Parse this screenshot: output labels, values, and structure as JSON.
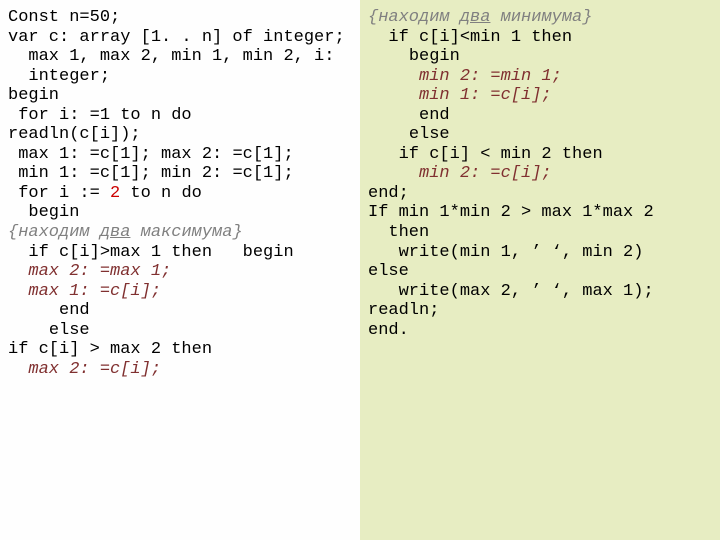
{
  "left": {
    "l01": "Const n=50;",
    "l02": "var c: array [1. . n] of integer;",
    "l03": "  max 1, max 2, min 1, min 2, i:",
    "l04": "  integer;",
    "l05": "begin",
    "l06": " for i: =1 to n do",
    "l07": "readln(c[i]);",
    "l08": " max 1: =c[1]; max 2: =c[1];",
    "l09": " min 1: =c[1]; min 2: =c[1];",
    "l10a": " for i := ",
    "l10b": "2",
    "l10c": " to n do",
    "l11": "  begin",
    "cmt_prefix": "{находим ",
    "cmt_word": "два",
    "cmt_suffix": " максимума}",
    "l13": "  if c[i]>max 1 then   begin",
    "l14": "  max 2: =max 1;",
    "l15": "  max 1: =c[i];",
    "l16": "     end",
    "l17": "    else",
    "l18": "if c[i] > max 2 then",
    "l19": "  max 2: =c[i];"
  },
  "right": {
    "cmt_prefix": "{находим ",
    "cmt_word": "два",
    "cmt_suffix": " минимума}",
    "r02": "  if c[i]<min 1 then",
    "r03": "    begin",
    "r04": "     min 2: =min 1;",
    "r05": "     min 1: =c[i];",
    "r06": "     end",
    "r07": "    else",
    "r08": "   if c[i] < min 2 then",
    "r09": "     min 2: =c[i];",
    "r10": "end;",
    "r11": "If min 1*min 2 > max 1*max 2",
    "r12": "  then",
    "r13": "   write(min 1, ’ ‘, min 2)",
    "r14": "else",
    "r15": "   write(max 2, ’ ‘, max 1);",
    "r16": "readln;",
    "r17": "end."
  }
}
